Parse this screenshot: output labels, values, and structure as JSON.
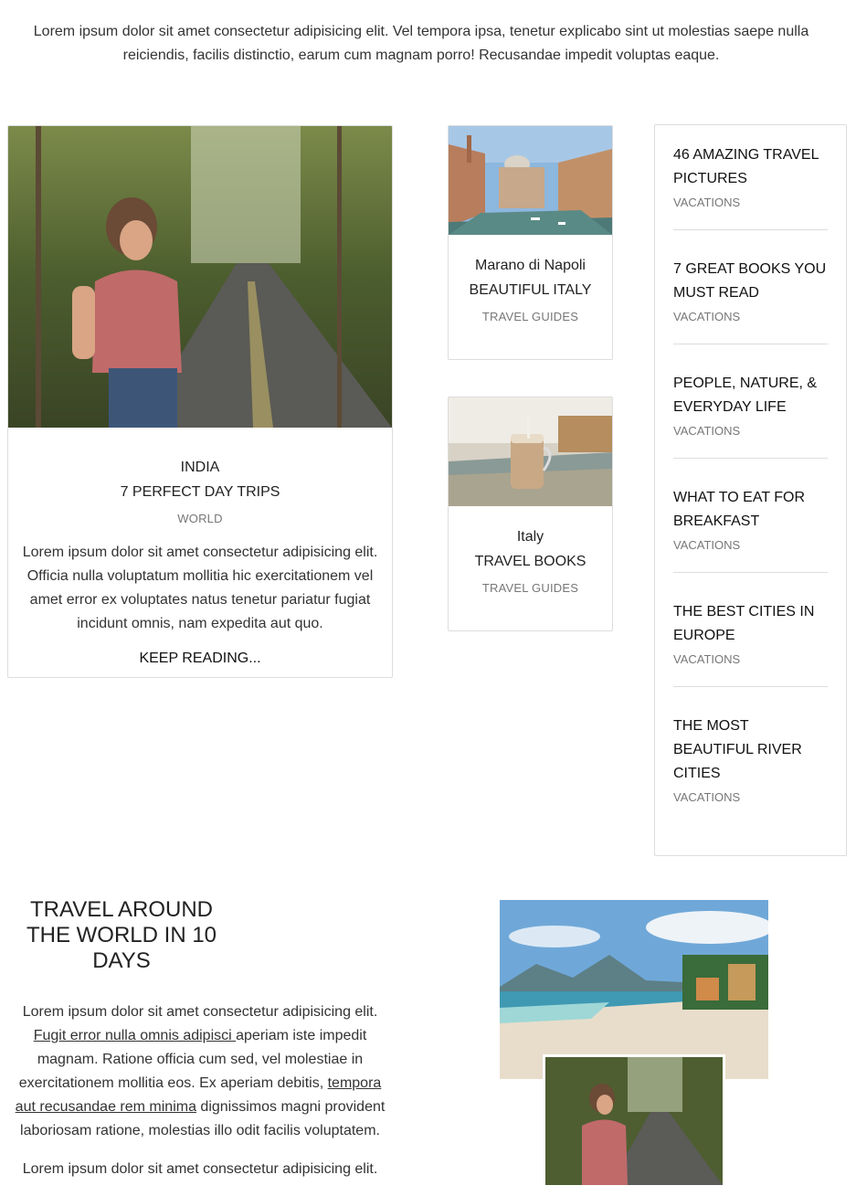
{
  "intro_text": "Lorem ipsum dolor sit amet consectetur adipisicing elit. Vel tempora ipsa, tenetur explicabo sint ut molestias saepe nulla reiciendis, facilis distinctio, earum cum magnam porro! Recusandae impedit voluptas eaque.",
  "feature": {
    "place": "INDIA",
    "title": "7 PERFECT DAY TRIPS",
    "category": "WORLD",
    "excerpt": "Lorem ipsum dolor sit amet consectetur adipisicing elit. Officia nulla voluptatum mollitia hic exercitationem vel amet error ex voluptates natus tenetur pariatur fugiat incidunt omnis, nam expedita aut quo.",
    "more": "KEEP READING..."
  },
  "small_cards": [
    {
      "place": "Marano di Napoli",
      "title": "BEAUTIFUL ITALY",
      "category": "TRAVEL GUIDES"
    },
    {
      "place": "Italy",
      "title": "TRAVEL BOOKS",
      "category": "TRAVEL GUIDES"
    }
  ],
  "sidebar": {
    "items": [
      {
        "title": "46 AMAZING TRAVEL PICTURES",
        "category": "VACATIONS"
      },
      {
        "title": "7 GREAT BOOKS YOU MUST READ",
        "category": "VACATIONS"
      },
      {
        "title": "PEOPLE, NATURE, & EVERYDAY LIFE",
        "category": "VACATIONS"
      },
      {
        "title": "WHAT TO EAT FOR BREAKFAST",
        "category": "VACATIONS"
      },
      {
        "title": "THE BEST CITIES IN EUROPE",
        "category": "VACATIONS"
      },
      {
        "title": "THE MOST BEAUTIFUL RIVER CITIES",
        "category": "VACATIONS"
      }
    ]
  },
  "travel": {
    "title": "TRAVEL AROUND THE WORLD IN 10 DAYS",
    "p1_a": "Lorem ipsum dolor sit amet consectetur adipisicing elit. ",
    "p1_link1": "Fugit error nulla omnis adipisci ",
    "p1_b": "aperiam iste impedit magnam. Ratione officia cum sed, vel molestiae in exercitationem mollitia eos. Ex aperiam debitis, ",
    "p1_link2": "tempora aut recusandae rem minima",
    "p1_c": " dignissimos magni provident laboriosam ratione, molestias illo odit facilis voluptatem.",
    "p2": "Lorem ipsum dolor sit amet consectetur adipisicing elit."
  }
}
